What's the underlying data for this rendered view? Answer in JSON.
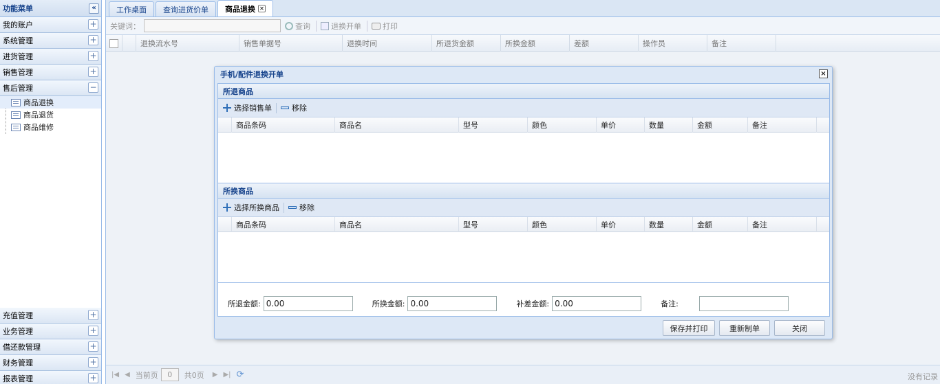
{
  "sidebar": {
    "title": "功能菜单",
    "collapse_icon": "«",
    "top_items": [
      {
        "label": "我的账户",
        "icon": "+"
      },
      {
        "label": "系统管理",
        "icon": "+"
      },
      {
        "label": "进货管理",
        "icon": "+"
      },
      {
        "label": "销售管理",
        "icon": "+"
      },
      {
        "label": "售后管理",
        "icon": "−"
      }
    ],
    "tree": [
      {
        "label": "商品退换"
      },
      {
        "label": "商品退货"
      },
      {
        "label": "商品维修"
      }
    ],
    "bottom_items": [
      {
        "label": "充值管理",
        "icon": "+"
      },
      {
        "label": "业务管理",
        "icon": "+"
      },
      {
        "label": "借还款管理",
        "icon": "+"
      },
      {
        "label": "财务管理",
        "icon": "+"
      },
      {
        "label": "报表管理",
        "icon": "+"
      }
    ]
  },
  "tabs": [
    {
      "label": "工作桌面"
    },
    {
      "label": "查询进货价单"
    },
    {
      "label": "商品退换"
    }
  ],
  "toolbar": {
    "keyword_label": "关键词：",
    "keyword_value": "",
    "search_label": "查询",
    "open_label": "退换开单",
    "print_label": "打印"
  },
  "grid": {
    "columns": [
      "退换流水号",
      "销售单据号",
      "退换时间",
      "所退货金额",
      "所换金额",
      "差额",
      "操作员",
      "备注"
    ]
  },
  "pager": {
    "current_page_label": "当前页",
    "current_page": "0",
    "total_label": "共0页",
    "no_records": "没有记录"
  },
  "dialog": {
    "title": "手机/配件退换开单",
    "close_icon": "×",
    "return_panel": {
      "title": "所退商品",
      "select_label": "选择销售单",
      "remove_label": "移除"
    },
    "exchange_panel": {
      "title": "所换商品",
      "select_label": "选择所换商品",
      "remove_label": "移除"
    },
    "columns": [
      "商品条码",
      "商品名",
      "型号",
      "颜色",
      "单价",
      "数量",
      "金额",
      "备注"
    ],
    "form": {
      "return_amount_label": "所退金额:",
      "return_amount": "0.00",
      "exchange_amount_label": "所换金额:",
      "exchange_amount": "0.00",
      "diff_amount_label": "补差金额:",
      "diff_amount": "0.00",
      "note_label": "备注:",
      "note": ""
    },
    "buttons": {
      "save_print": "保存并打印",
      "reset": "重新制单",
      "close": "关闭"
    }
  }
}
